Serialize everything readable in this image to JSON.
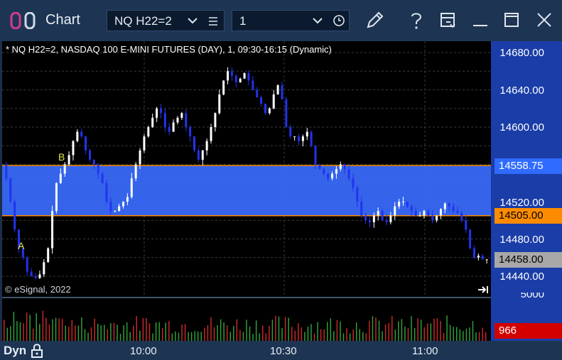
{
  "window": {
    "title": "Chart"
  },
  "toolbar": {
    "symbol": "NQ H22=2",
    "interval": "1"
  },
  "chart": {
    "title": "* NQ H22=2, NASDAQ 100 E-MINI FUTURES (DAY), 1, 09:30-16:15 (Dynamic)",
    "copyright": "© eSignal, 2022",
    "price_labels": [
      "14680.00",
      "14640.00",
      "14600.00",
      "14520.00",
      "14480.00",
      "14440.00"
    ],
    "volume_label": "5000",
    "tags": {
      "upper": "14558.75",
      "lower": "14505.00",
      "last": "14458.00",
      "volume": "966"
    },
    "point_labels": {
      "a": "A",
      "b": "B"
    },
    "time_labels": [
      "10:00",
      "10:30",
      "11:00"
    ],
    "mode": "Dyn"
  },
  "chart_data": {
    "type": "candlestick",
    "y_axis_ticks": [
      14680,
      14640,
      14600,
      14520,
      14480,
      14440
    ],
    "zone": {
      "upper": 14558.75,
      "lower": 14505.0
    },
    "last_price": 14458.0,
    "last_volume": 966,
    "x_ticks": [
      "10:00",
      "10:30",
      "11:00"
    ],
    "price_path": [
      14560,
      14545,
      14520,
      14490,
      14470,
      14460,
      14445,
      14440,
      14438,
      14442,
      14455,
      14470,
      14510,
      14540,
      14550,
      14560,
      14570,
      14585,
      14595,
      14590,
      14575,
      14565,
      14560,
      14550,
      14540,
      14520,
      14510,
      14510,
      14515,
      14520,
      14525,
      14545,
      14560,
      14575,
      14590,
      14600,
      14610,
      14620,
      14615,
      14600,
      14595,
      14605,
      14610,
      14615,
      14600,
      14590,
      14575,
      14565,
      14575,
      14585,
      14600,
      14615,
      14635,
      14650,
      14660,
      14655,
      14648,
      14652,
      14658,
      14650,
      14640,
      14632,
      14625,
      14615,
      14620,
      14635,
      14645,
      14630,
      14600,
      14590,
      14590,
      14585,
      14590,
      14595,
      14580,
      14560,
      14555,
      14550,
      14545,
      14550,
      14555,
      14560,
      14555,
      14545,
      14535,
      14520,
      14505,
      14500,
      14498,
      14505,
      14510,
      14500,
      14498,
      14505,
      14515,
      14520,
      14520,
      14515,
      14510,
      14505,
      14505,
      14510,
      14505,
      14500,
      14505,
      14512,
      14518,
      14515,
      14510,
      14508,
      14500,
      14490,
      14470,
      14460,
      14462,
      14458,
      14458
    ]
  }
}
